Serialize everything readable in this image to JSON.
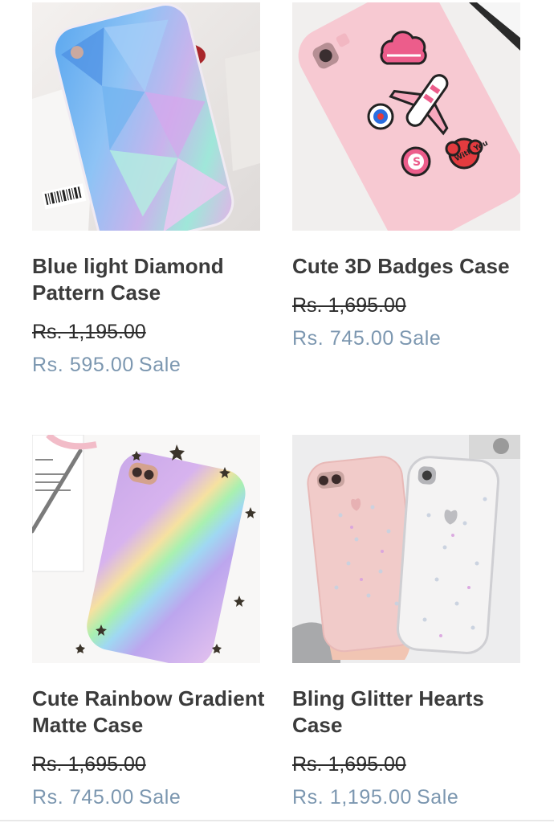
{
  "products": [
    {
      "title": "Blue light Diamond Pattern Case",
      "original_price": "Rs. 1,195.00",
      "sale_price": "Rs. 595.00",
      "sale_label": "Sale"
    },
    {
      "title": "Cute 3D Badges Case",
      "original_price": "Rs. 1,695.00",
      "sale_price": "Rs. 745.00",
      "sale_label": "Sale"
    },
    {
      "title": "Cute Rainbow Gradient Matte Case",
      "original_price": "Rs. 1,695.00",
      "sale_price": "Rs. 745.00",
      "sale_label": "Sale"
    },
    {
      "title": "Bling Glitter Hearts Case",
      "original_price": "Rs. 1,695.00",
      "sale_price": "Rs. 1,195.00",
      "sale_label": "Sale"
    }
  ],
  "colors": {
    "title": "#3b3b3b",
    "original_price": "#2c2c2c",
    "sale_price": "#7c97b0"
  }
}
